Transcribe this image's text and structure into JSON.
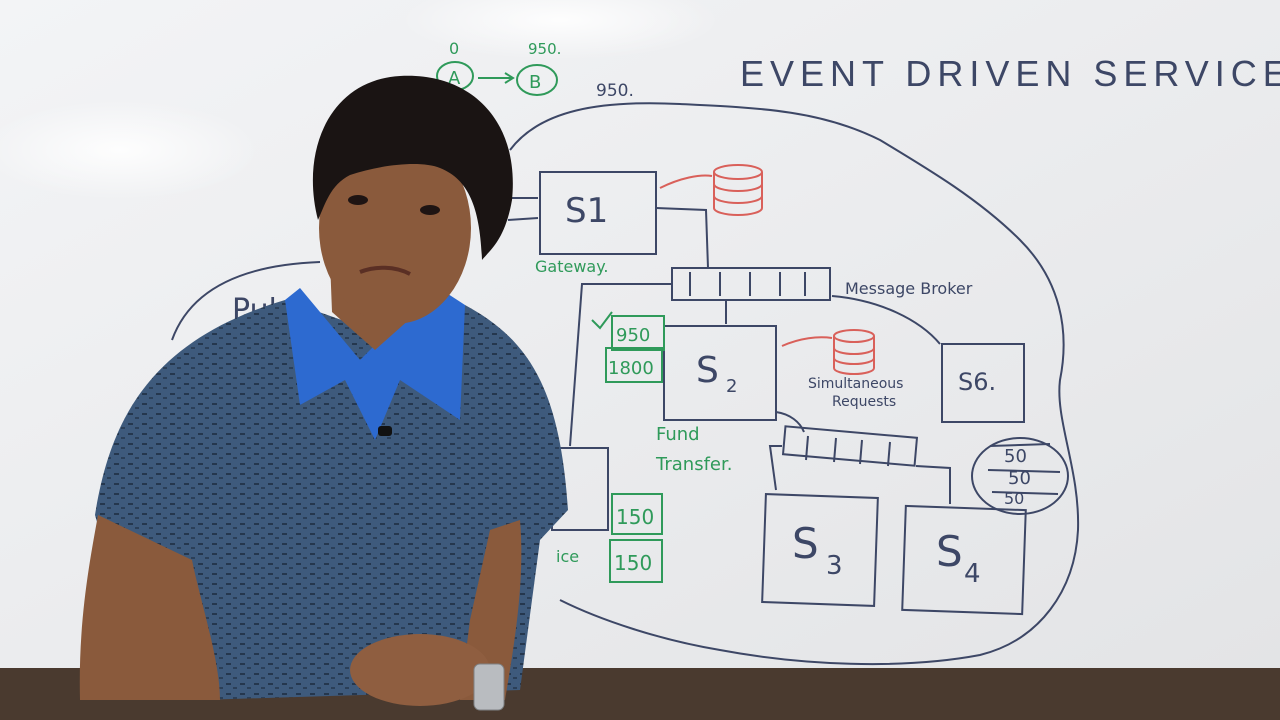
{
  "board": {
    "title": "EVENT DRIVEN SERVICES",
    "colors": {
      "ink_blue": "#3d4766",
      "ink_green": "#2f9a5a",
      "ink_red": "#d9605a",
      "board": "#ecedef",
      "shirt": "#3e5a7c",
      "collar": "#2d6ad0"
    }
  },
  "annotations": {
    "top_a": "A",
    "top_b": "B",
    "top_zero": "0",
    "top_950a": "950.",
    "top_950b": "950.",
    "gateway_label": "Gateway.",
    "public_label": "Publi",
    "message_broker": "Message Broker",
    "simultaneous": "Simultaneous",
    "requests": "Requests",
    "fund": "Fund",
    "transfer": "Transfer.",
    "service_partial": "ice",
    "amount_950": "950",
    "amount_1800": "1800",
    "amount_150a": "150",
    "amount_150b": "150",
    "stack_50a": "50",
    "stack_50b": "50",
    "stack_50c": "50"
  },
  "services": {
    "s1": "S1",
    "s2": "S",
    "s2_sub": "2",
    "s3": "S",
    "s3_sub": "3",
    "s4": "S",
    "s4_sub": "4",
    "s6": "S6."
  }
}
